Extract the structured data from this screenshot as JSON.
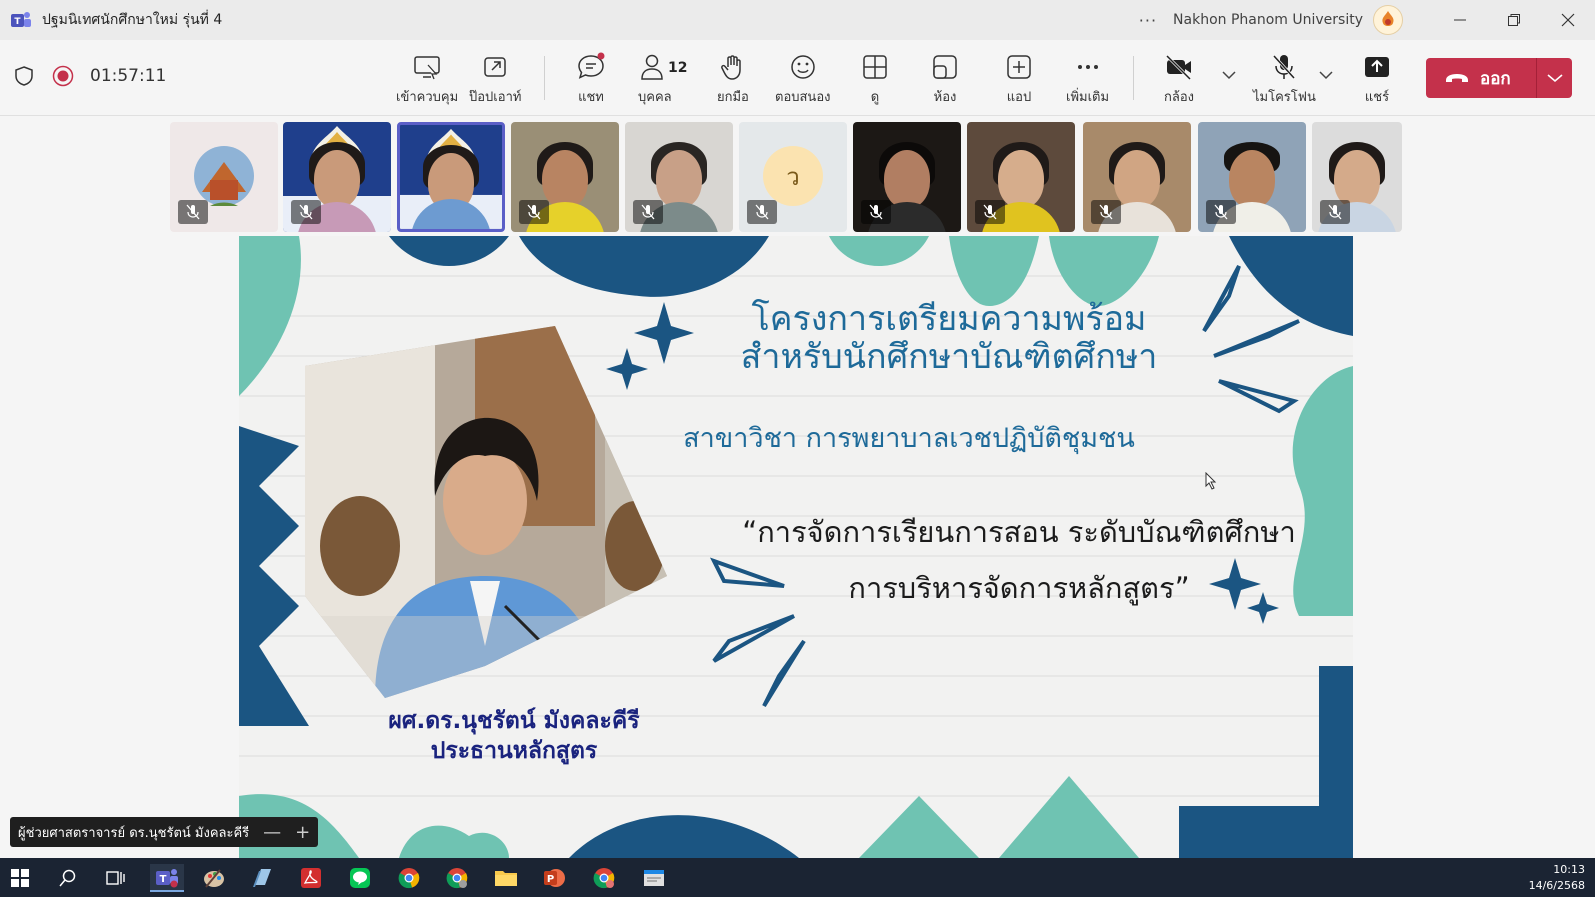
{
  "window": {
    "title": "ปฐมนิเทศนักศึกษาใหม่ รุ่นที่ 4",
    "more": "···",
    "org": "Nakhon Phanom University"
  },
  "toolbar": {
    "timer": "01:57:11",
    "tools": [
      {
        "name": "control",
        "label": "เข้าควบคุม"
      },
      {
        "name": "popout",
        "label": "ป๊อปเอาท์"
      },
      {
        "name": "chat",
        "label": "แชท"
      },
      {
        "name": "people",
        "label": "บุคคล",
        "count": "12"
      },
      {
        "name": "raise-hand",
        "label": "ยกมือ"
      },
      {
        "name": "react",
        "label": "ตอบสนอง"
      },
      {
        "name": "view",
        "label": "ดู"
      },
      {
        "name": "rooms",
        "label": "ห้อง"
      },
      {
        "name": "apps",
        "label": "แอป"
      },
      {
        "name": "more",
        "label": "เพิ่มเติม"
      },
      {
        "name": "camera",
        "label": "กล้อง"
      },
      {
        "name": "mic",
        "label": "ไมโครโฟน"
      },
      {
        "name": "share",
        "label": "แชร์"
      }
    ],
    "leave_label": "ออก"
  },
  "participants": [
    {
      "kind": "temple"
    },
    {
      "kind": "logo"
    },
    {
      "kind": "logo"
    },
    {
      "kind": "person"
    },
    {
      "kind": "person"
    },
    {
      "kind": "initial",
      "initial": "ว"
    },
    {
      "kind": "person"
    },
    {
      "kind": "person"
    },
    {
      "kind": "person"
    },
    {
      "kind": "person"
    },
    {
      "kind": "person"
    }
  ],
  "slide": {
    "title_line1": "โครงการเตรียมความพร้อม",
    "title_line2": "สำหรับนักศึกษาบัณฑิตศึกษา",
    "program": "สาขาวิชา การพยาบาลเวชปฏิบัติชุมชน",
    "topic_line1": "“การจัดการเรียนการสอน ระดับบัณฑิตศึกษา",
    "topic_line2": "การบริหารจัดการหลักสูตร”",
    "speaker_line1": "ผศ.ดร.นุชรัตน์ มังคละคีรี",
    "speaker_line2": "ประธานหลักสูตร"
  },
  "speaker_tag": {
    "name": "ผู้ช่วยศาสตราจารย์ ดร.นุชรัตน์ มังคละคีรี",
    "zoom_out": "—",
    "zoom_in": "+"
  },
  "taskbar": {
    "time": "10:13",
    "date": "14/6/2568"
  },
  "colors": {
    "accent": "#5b5fc7",
    "leave": "#c4314b",
    "slide_navy": "#1b5582",
    "slide_teal": "#6fc3b2"
  }
}
